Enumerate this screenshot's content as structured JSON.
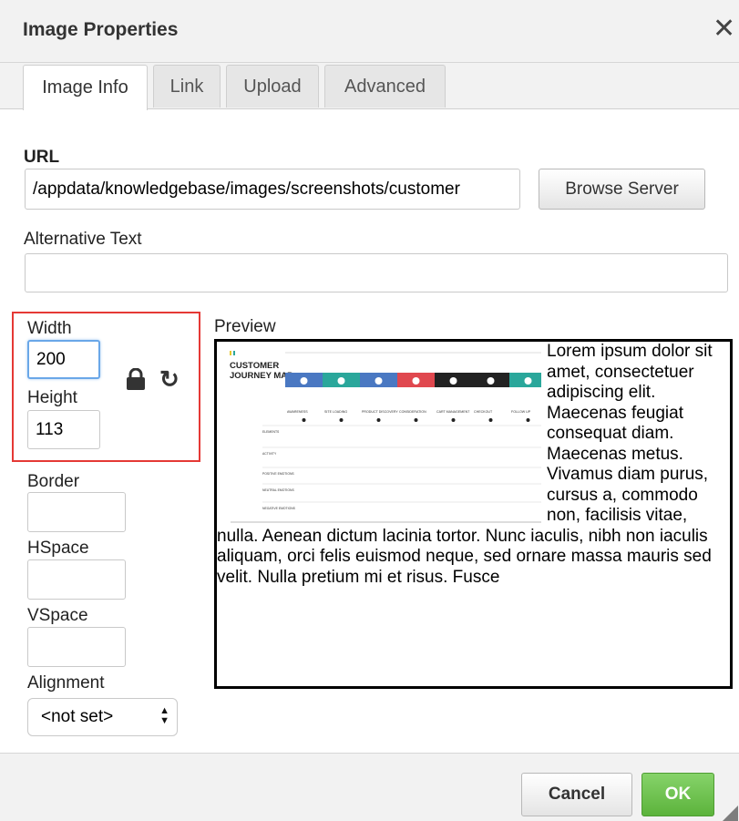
{
  "dialog": {
    "title": "Image Properties",
    "close_icon": "close-icon"
  },
  "tabs": [
    {
      "label": "Image Info",
      "active": true
    },
    {
      "label": "Link",
      "active": false
    },
    {
      "label": "Upload",
      "active": false
    },
    {
      "label": "Advanced",
      "active": false
    }
  ],
  "url": {
    "label": "URL",
    "value": "/appdata/knowledgebase/images/screenshots/customer",
    "browse_label": "Browse Server"
  },
  "alt_text": {
    "label": "Alternative Text",
    "value": ""
  },
  "dimensions": {
    "width_label": "Width",
    "width_value": "200",
    "height_label": "Height",
    "height_value": "113",
    "lock_icon": "lock-icon",
    "reset_icon": "reset-size-icon"
  },
  "spacing": {
    "border_label": "Border",
    "border_value": "",
    "hspace_label": "HSpace",
    "hspace_value": "",
    "vspace_label": "VSpace",
    "vspace_value": ""
  },
  "alignment": {
    "label": "Alignment",
    "value": "<not set>"
  },
  "preview": {
    "label": "Preview",
    "image": {
      "title_line1": "CUSTOMER",
      "title_line2": "JOURNEY MAP",
      "stages": [
        "AWARENESS",
        "SITE LOADING",
        "PRODUCT DISCOVERY",
        "CONSIDERATION",
        "CART MANAGEMENT",
        "CHECKOUT",
        "FOLLOW UP"
      ],
      "rows": [
        "ELEMENTS",
        "ACTIVITY",
        "POSITIVE EMOTIONS",
        "NEUTRAL EMOTIONS",
        "NEGATIVE EMOTIONS"
      ]
    },
    "text": "Lorem ipsum dolor sit amet, consectetuer adipiscing elit. Maecenas feugiat consequat diam. Maecenas metus. Vivamus diam purus, cursus a, commodo non, facilisis vitae, nulla. Aenean dictum lacinia tortor. Nunc iaculis, nibh non iaculis aliquam, orci felis euismod neque, sed ornare massa mauris sed velit. Nulla pretium mi et risus. Fusce"
  },
  "footer": {
    "cancel_label": "Cancel",
    "ok_label": "OK",
    "resize_icon": "resize-grip-icon"
  },
  "colors": {
    "accent_red": "#e53935",
    "ok_green": "#5cb33c",
    "focus_blue": "#6aa7e8",
    "stage_colors": [
      "#4a78c2",
      "#2aa79b",
      "#4a78c2",
      "#e0484f",
      "#222222",
      "#222222",
      "#2aa79b"
    ]
  }
}
